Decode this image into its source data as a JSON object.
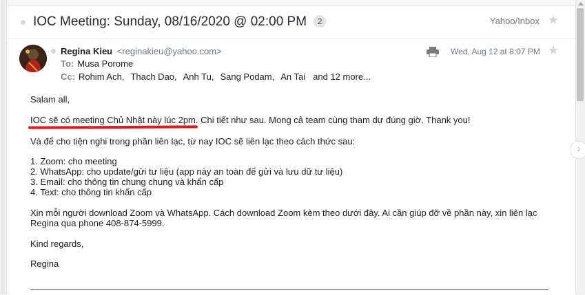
{
  "message": {
    "subject": "IOC Meeting: Sunday, 08/16/2020 @ 02:00 PM",
    "thread_count": "2",
    "folder": "Yahoo/Inbox",
    "sender_name": "Regina Kieu",
    "sender_email": "<reginakieu@yahoo.com>",
    "to_label": "To:",
    "to_value": "Musa Porome",
    "cc_label": "Cc:",
    "cc_recipients": [
      "Rohim Ach,",
      "Thach Dao,",
      "Anh Tu,",
      "Sang Podam,",
      "An Tai"
    ],
    "cc_more": "and 12 more...",
    "date": "Wed, Aug 12 at 8:07 PM"
  },
  "body": {
    "greeting": "Salam all,",
    "highlight": "IOC sẽ có meeting Chủ Nhật này lúc 2pm.",
    "line1_rest": " Chi tiết như sau. Mong cả team cùng tham dự đúng giờ. Thank you!",
    "line2": "Và để cho tiện nghi trong phần liên lạc, từ nay IOC sẽ liên lạc theo cách thức sau:",
    "list": [
      "1. Zoom: cho meeting",
      "2. WhatsApp: cho update/gửi tư liệu (app này an toàn để gửi và lưu dữ tư liệu)",
      "3. Email: cho thông tin chung chung và khẩn cấp",
      "4. Text: cho thông tin khẩn cấp"
    ],
    "para_line1": "Xin mỗi người download Zoom và WhatsApp. Cách download Zoom kèm theo dưới đây. Ai cần giúp đỡ về phần này, xin liên lạc",
    "para_line2": "Regina qua phone 408-874-5999.",
    "closing": "Kind regards,",
    "signature": "Regina"
  },
  "icons": {
    "star": "star-icon",
    "print": "print-icon",
    "next": "chevron-right-icon",
    "highlight_underline_color": "#e0191e"
  }
}
